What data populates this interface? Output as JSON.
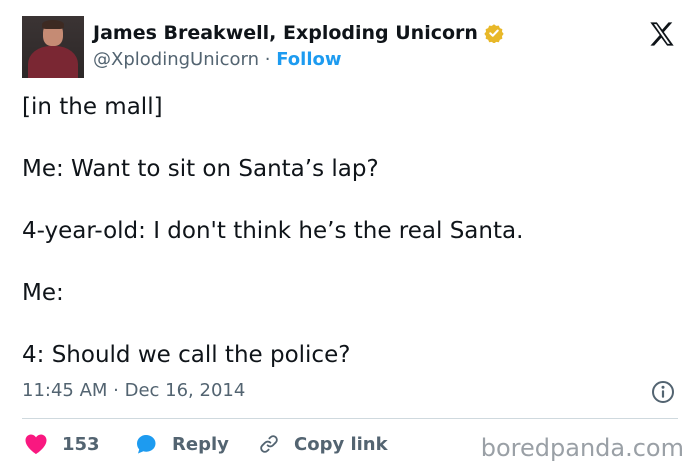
{
  "author": {
    "name": "James Breakwell, Exploding Unicorn",
    "handle": "@XplodingUnicorn",
    "separator": "·",
    "follow_label": "Follow",
    "verified_color": "#e8b829"
  },
  "tweet": {
    "lines": [
      "[in the mall]",
      "Me: Want to sit on Santa’s lap?",
      "4-year-old: I don't think he’s the real Santa.",
      "Me:",
      "4: Should we call the police?"
    ]
  },
  "meta": {
    "timestamp": "11:45 AM · Dec 16, 2014"
  },
  "actions": {
    "like_count": "153",
    "reply_label": "Reply",
    "copy_link_label": "Copy link"
  },
  "watermark": "boredpanda.com",
  "colors": {
    "accent": "#1d9bf0",
    "like": "#f91880",
    "text": "#0f1419",
    "muted": "#536471"
  }
}
